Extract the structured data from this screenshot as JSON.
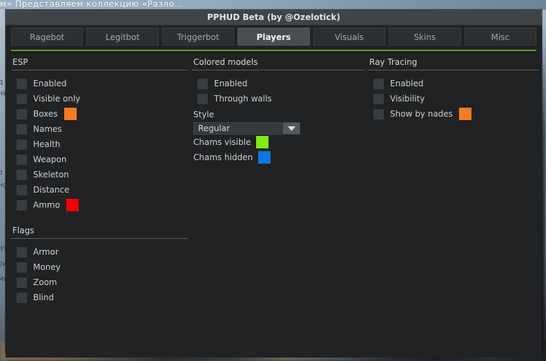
{
  "background": {
    "browser_tab_text": "м» Представляем коллекцию «Разло…",
    "side_fragments": [
      "д",
      "ни",
      "о",
      "нg",
      "ит",
      "ои",
      "ми"
    ]
  },
  "window": {
    "title": "PPHUD Beta (by @Ozelotick)",
    "accent_color": "#5fa01e"
  },
  "tabs": [
    {
      "label": "Ragebot",
      "active": false
    },
    {
      "label": "Legitbot",
      "active": false
    },
    {
      "label": "Triggerbot",
      "active": false
    },
    {
      "label": "Players",
      "active": true
    },
    {
      "label": "Visuals",
      "active": false
    },
    {
      "label": "Skins",
      "active": false
    },
    {
      "label": "Misc",
      "active": false
    }
  ],
  "sections": {
    "esp": {
      "title": "ESP",
      "items": [
        {
          "label": "Enabled",
          "checked": false,
          "color": null
        },
        {
          "label": "Visible only",
          "checked": false,
          "color": null
        },
        {
          "label": "Boxes",
          "checked": false,
          "color": "#f57c1f"
        },
        {
          "label": "Names",
          "checked": false,
          "color": null
        },
        {
          "label": "Health",
          "checked": false,
          "color": null
        },
        {
          "label": "Weapon",
          "checked": false,
          "color": null
        },
        {
          "label": "Skeleton",
          "checked": false,
          "color": null
        },
        {
          "label": "Distance",
          "checked": false,
          "color": null
        },
        {
          "label": "Ammo",
          "checked": false,
          "color": "#f60000"
        }
      ]
    },
    "flags": {
      "title": "Flags",
      "items": [
        {
          "label": "Armor",
          "checked": false,
          "color": null
        },
        {
          "label": "Money",
          "checked": false,
          "color": null
        },
        {
          "label": "Zoom",
          "checked": false,
          "color": null
        },
        {
          "label": "Blind",
          "checked": false,
          "color": null
        }
      ]
    },
    "colored_models": {
      "title": "Colored models",
      "items": [
        {
          "label": "Enabled",
          "checked": false,
          "color": null
        },
        {
          "label": "Through walls",
          "checked": false,
          "color": null
        }
      ],
      "style_label": "Style",
      "style_value": "Regular",
      "chams_visible_label": "Chams visible",
      "chams_visible_color": "#7cf00a",
      "chams_hidden_label": "Chams hidden",
      "chams_hidden_color": "#0a78e8"
    },
    "ray_tracing": {
      "title": "Ray Tracing",
      "items": [
        {
          "label": "Enabled",
          "checked": false,
          "color": null
        },
        {
          "label": "Visibility",
          "checked": false,
          "color": null
        },
        {
          "label": "Show by nades",
          "checked": false,
          "color": "#f57c1f"
        }
      ]
    }
  }
}
